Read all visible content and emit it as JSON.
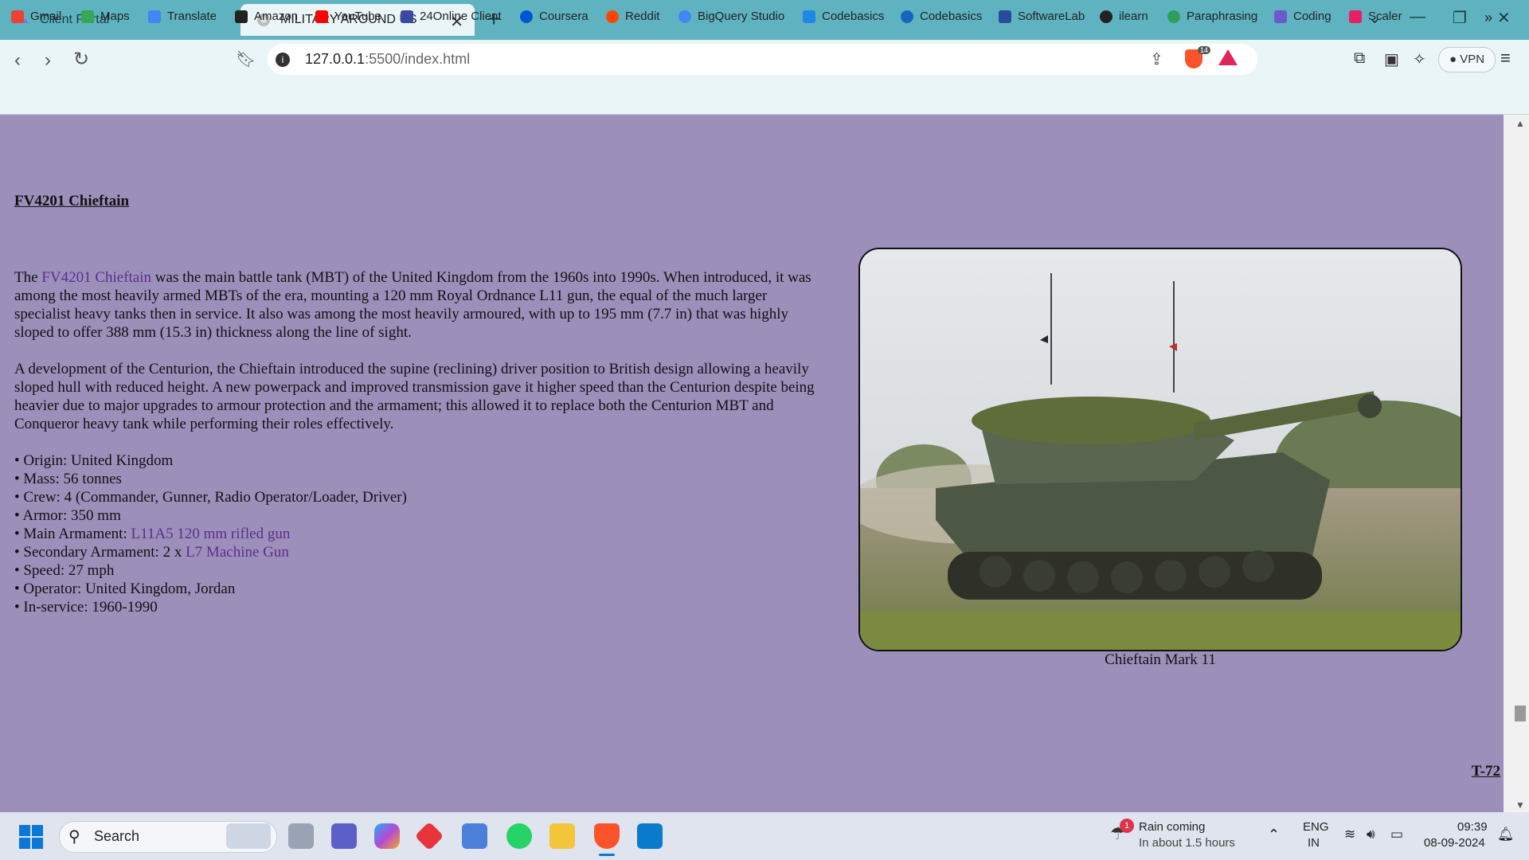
{
  "browser": {
    "tabs": [
      {
        "title": "Client Portal",
        "active": false
      },
      {
        "title": "MILITARY AROUND US",
        "active": true
      }
    ],
    "url_host": "127.0.0.1",
    "url_path": ":5500/index.html",
    "vpn_label": "VPN",
    "shield_count": "14",
    "bookmarks": [
      {
        "label": "Gmail",
        "color": "#ea4335"
      },
      {
        "label": "Maps",
        "color": "#34a853"
      },
      {
        "label": "Translate",
        "color": "#4285f4"
      },
      {
        "label": "Amazon",
        "color": "#222222"
      },
      {
        "label": "YouTube",
        "color": "#ff0000"
      },
      {
        "label": "24Online Client",
        "color": "#3b4aa0"
      },
      {
        "label": "Coursera",
        "color": "#0056d2"
      },
      {
        "label": "Reddit",
        "color": "#ff4500"
      },
      {
        "label": "BigQuery Studio",
        "color": "#4285f4"
      },
      {
        "label": "Codebasics",
        "color": "#1e88e5"
      },
      {
        "label": "Codebasics",
        "color": "#1565c0"
      },
      {
        "label": "SoftwareLab",
        "color": "#2b4a9e"
      },
      {
        "label": "ilearn",
        "color": "#222222"
      },
      {
        "label": "Paraphrasing",
        "color": "#2e9e5b"
      },
      {
        "label": "Coding",
        "color": "#6a5acd"
      },
      {
        "label": "Scaler",
        "color": "#e91e63"
      }
    ]
  },
  "page": {
    "heading": "FV4201 Chieftain",
    "para1_prefix": "The ",
    "para1_link": "FV4201 Chieftain",
    "para1_rest": " was the main battle tank (MBT) of the United Kingdom from the 1960s into 1990s. When introduced, it was among the most heavily armed MBTs of the era, mounting a 120 mm Royal Ordnance L11 gun, the equal of the much larger specialist heavy tanks then in service. It also was among the most heavily armoured, with up to 195 mm (7.7 in) that was highly sloped to offer 388 mm (15.3 in) thickness along the line of sight.",
    "para2": "A development of the Centurion, the Chieftain introduced the supine (reclining) driver position to British design allowing a heavily sloped hull with reduced height. A new powerpack and improved transmission gave it higher speed than the Centurion despite being heavier due to major upgrades to armour protection and the armament; this allowed it to replace both the Centurion MBT and Conqueror heavy tank while performing their roles effectively.",
    "spec_origin": "• Origin: United Kingdom",
    "spec_mass": "• Mass: 56 tonnes",
    "spec_crew": "• Crew: 4 (Commander, Gunner, Radio Operator/Loader, Driver)",
    "spec_armor": "• Armor: 350 mm",
    "spec_main_prefix": "• Main Armament: ",
    "spec_main_link": "L11A5 120 mm rifled gun",
    "spec_secondary_prefix": "• Secondary Armament: 2 x ",
    "spec_secondary_link": "L7 Machine Gun",
    "spec_speed": "• Speed: 27 mph",
    "spec_operator": "• Operator: United Kingdom, Jordan",
    "spec_service": "• In-service: 1960-1990",
    "image_caption": "Chieftain Mark 11",
    "next_link": "T-72"
  },
  "taskbar": {
    "search_placeholder": "Search",
    "weather_title": "Rain coming",
    "weather_sub": "In about 1.5 hours",
    "weather_badge": "1",
    "lang_top": "ENG",
    "lang_bottom": "IN",
    "time": "09:39",
    "date": "08-09-2024"
  }
}
